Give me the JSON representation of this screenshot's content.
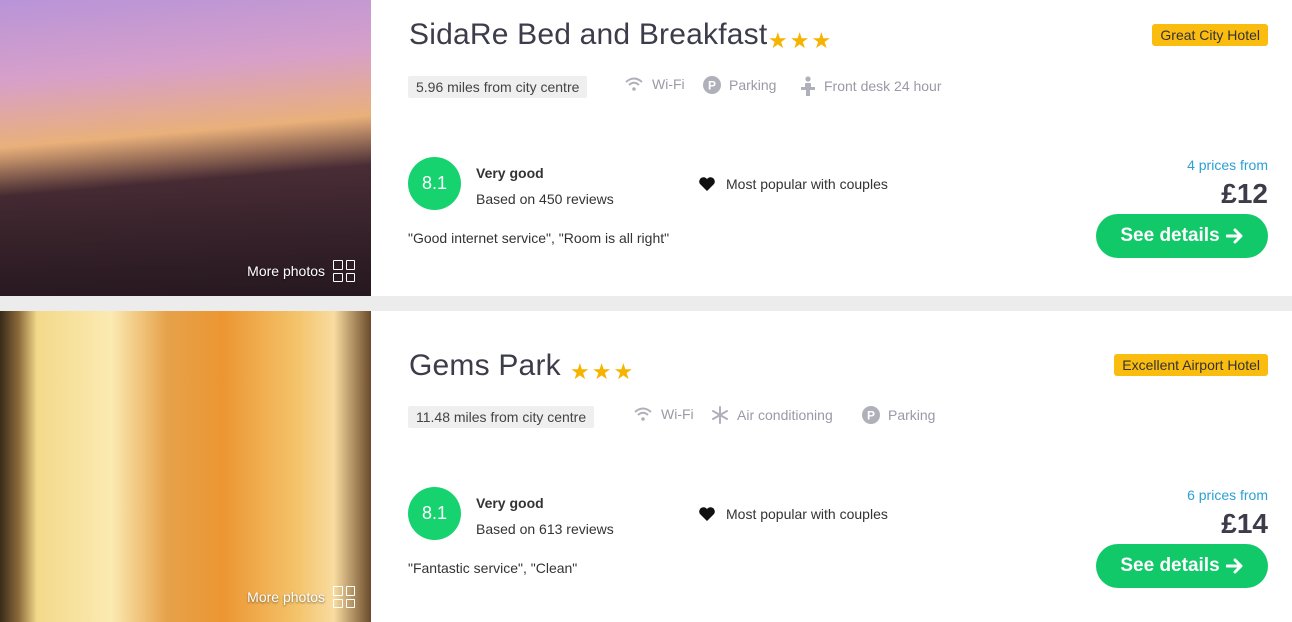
{
  "listings": [
    {
      "name": "SidaRe Bed and Breakfast",
      "stars": "★★★",
      "badge": "Great City Hotel",
      "distance": "5.96 miles from city centre",
      "amenities": [
        "Wi-Fi",
        "Parking",
        "Front desk 24 hour"
      ],
      "score": "8.1",
      "rating_label": "Very good",
      "reviews": "Based on 450 reviews",
      "popular": "Most popular with couples",
      "quote": "\"Good internet service\", \"Room is all right\"",
      "prices_from": "4 prices from",
      "price": "£12",
      "button": "See details",
      "more_photos": "More photos"
    },
    {
      "name": "Gems Park",
      "stars": "★★★",
      "badge": "Excellent Airport Hotel",
      "distance": "11.48 miles from city centre",
      "amenities": [
        "Wi-Fi",
        "Air conditioning",
        "Parking"
      ],
      "score": "8.1",
      "rating_label": "Very good",
      "reviews": "Based on 613 reviews",
      "popular": "Most popular with couples",
      "quote": "\"Fantastic service\", \"Clean\"",
      "prices_from": "6 prices from",
      "price": "£14",
      "button": "See details",
      "more_photos": "More photos"
    }
  ],
  "colors": {
    "accent_green": "#12c96a",
    "badge_yellow": "#fbbc10",
    "star": "#f6b400",
    "link_blue": "#2aa0d6"
  },
  "icons": [
    "wifi-icon",
    "parking-icon",
    "front-desk-icon",
    "snowflake-icon",
    "heart-icon",
    "grid-icon",
    "arrow-right-icon"
  ]
}
